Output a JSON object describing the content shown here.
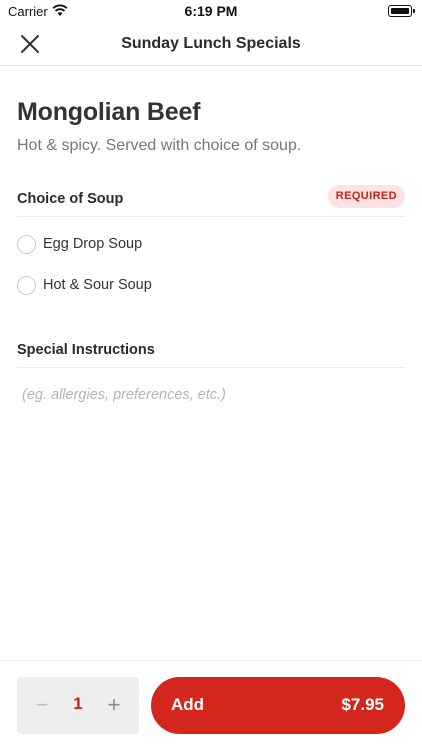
{
  "status_bar": {
    "carrier": "Carrier",
    "time": "6:19 PM"
  },
  "nav": {
    "title": "Sunday Lunch Specials",
    "close_icon": "close-icon"
  },
  "item": {
    "name": "Mongolian Beef",
    "description": "Hot & spicy. Served with choice of soup."
  },
  "soup_section": {
    "label": "Choice of Soup",
    "badge": "REQUIRED",
    "options": [
      {
        "label": "Egg Drop Soup",
        "selected": false
      },
      {
        "label": "Hot & Sour Soup",
        "selected": false
      }
    ]
  },
  "instructions": {
    "label": "Special Instructions",
    "value": "",
    "placeholder": "(eg. allergies, preferences, etc.)"
  },
  "cart": {
    "minus_symbol": "−",
    "quantity": "1",
    "plus_symbol": "+",
    "add_label": "Add",
    "price": "$7.95"
  },
  "colors": {
    "accent": "#d3261d",
    "badge_bg": "#fbe3e3",
    "badge_text": "#c8211a",
    "stepper_bg": "#eeeeee"
  }
}
